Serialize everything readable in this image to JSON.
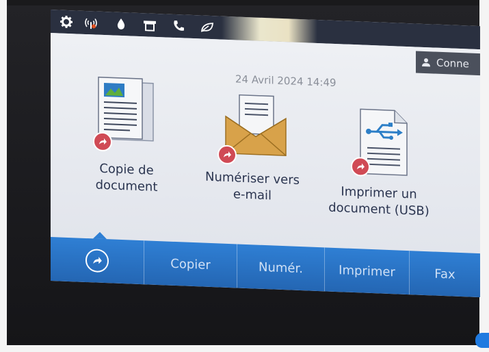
{
  "status_bar": {
    "icons": [
      "gear-icon",
      "wireless-icon",
      "ink-drop-icon",
      "paper-tray-icon",
      "phone-icon",
      "eco-leaf-icon"
    ]
  },
  "sign_in": {
    "label": "Conne"
  },
  "datetime": "24 Avril 2024 14:49",
  "tiles": [
    {
      "line1": "Copie de",
      "line2": "document"
    },
    {
      "line1": "Numériser vers",
      "line2": "e-mail"
    },
    {
      "line1": "Imprimer un",
      "line2": "document (USB)"
    }
  ],
  "tabs": [
    {
      "label": "Copier"
    },
    {
      "label": "Numér."
    },
    {
      "label": "Imprimer"
    },
    {
      "label": "Fax"
    }
  ],
  "colors": {
    "tab_bar": "#2f7fd4",
    "badge": "#d04a55",
    "status_bar": "#2a3040"
  }
}
